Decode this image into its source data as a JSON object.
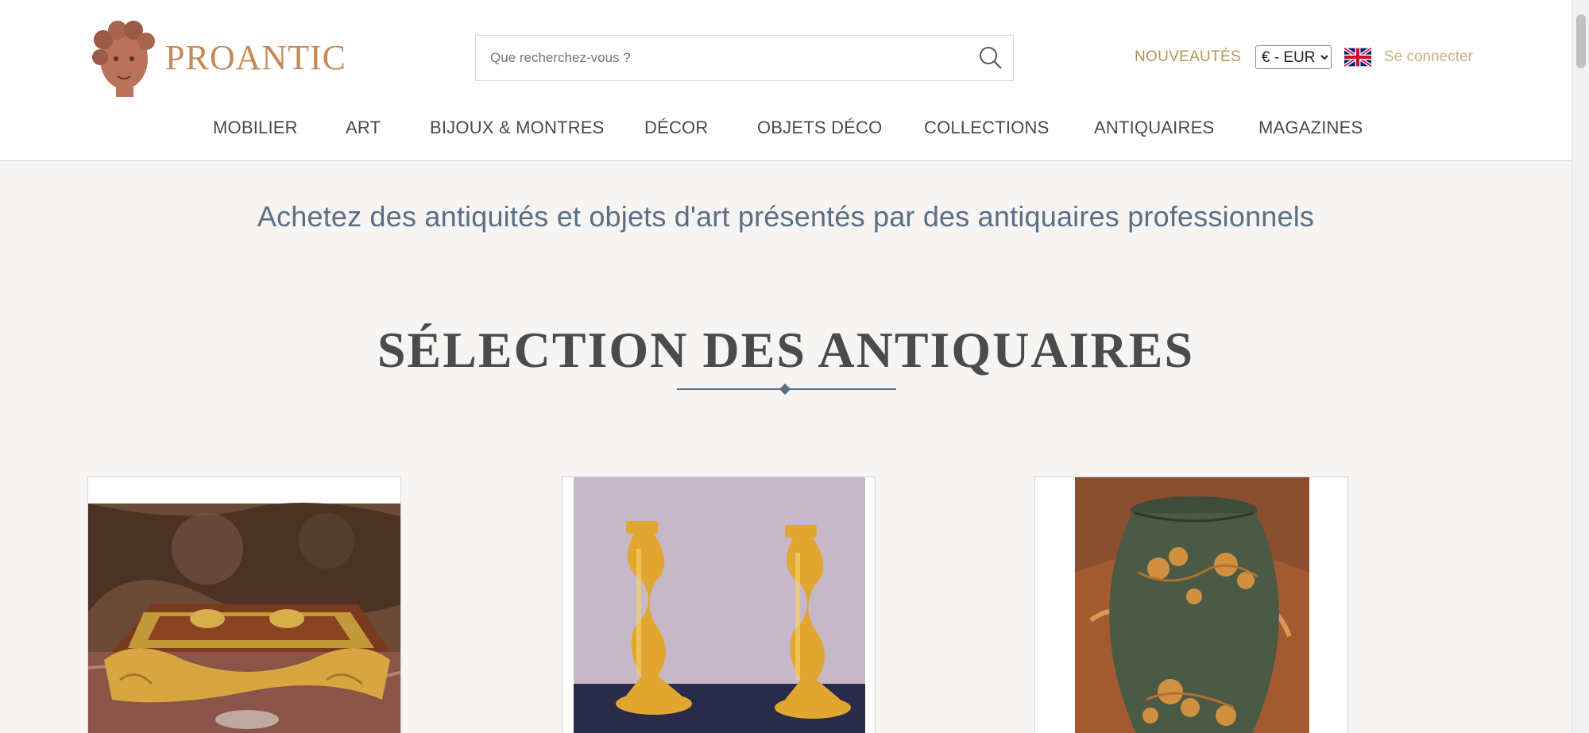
{
  "header": {
    "logo_text": "PROANTIC",
    "search": {
      "placeholder": "Que recherchez-vous ?"
    },
    "nouveautes": "NOUVEAUTÉS",
    "currency": {
      "selected": "€ - EUR"
    },
    "flag_icon": "uk-flag-icon",
    "login": "Se connecter"
  },
  "nav": {
    "items": [
      {
        "label": "MOBILIER"
      },
      {
        "label": "ART"
      },
      {
        "label": "BIJOUX & MONTRES"
      },
      {
        "label": "DÉCOR"
      },
      {
        "label": "OBJETS DÉCO"
      },
      {
        "label": "COLLECTIONS"
      },
      {
        "label": "ANTIQUAIRES"
      },
      {
        "label": "MAGAZINES"
      }
    ]
  },
  "main": {
    "tagline": "Achetez des antiquités et objets d'art présentés par des antiquaires professionnels",
    "section_title": "SÉLECTION DES ANTIQUAIRES",
    "cards": [
      {
        "icon": "inkstand-product-image"
      },
      {
        "icon": "candlesticks-product-image"
      },
      {
        "icon": "vase-product-image"
      }
    ]
  },
  "colors": {
    "accent": "#b29556",
    "logo": "#c88a55",
    "tagline": "#5b6e86",
    "background": "#f6f5f3"
  }
}
